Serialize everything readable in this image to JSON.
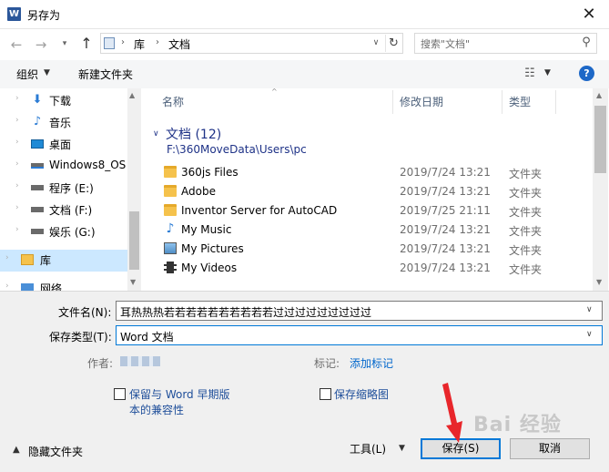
{
  "window": {
    "app_icon": "W",
    "title": "另存为",
    "close_glyph": "✕"
  },
  "address": {
    "crumbs": [
      "库",
      "文档"
    ],
    "search_placeholder": "搜索\"文档\""
  },
  "toolbar": {
    "organize": "组织",
    "new_folder": "新建文件夹",
    "help": "?"
  },
  "nav": {
    "items": [
      {
        "label": "下载",
        "icon": "download-icon"
      },
      {
        "label": "音乐",
        "icon": "music-icon"
      },
      {
        "label": "桌面",
        "icon": "desktop-icon"
      },
      {
        "label": "Windows8_OS",
        "icon": "drive-icon"
      },
      {
        "label": "程序 (E:)",
        "icon": "drive-icon"
      },
      {
        "label": "文档 (F:)",
        "icon": "drive-icon"
      },
      {
        "label": "娱乐 (G:)",
        "icon": "drive-icon"
      },
      {
        "label": "库",
        "icon": "library-icon"
      },
      {
        "label": "网络",
        "icon": "network-icon"
      }
    ]
  },
  "files": {
    "columns": {
      "name": "名称",
      "date": "修改日期",
      "type": "类型"
    },
    "group_title": "文档 (12)",
    "group_path": "F:\\360MoveData\\Users\\pc",
    "rows": [
      {
        "name": "360js Files",
        "date": "2019/7/24 13:21",
        "type": "文件夹",
        "icon": "folder-icon"
      },
      {
        "name": "Adobe",
        "date": "2019/7/24 13:21",
        "type": "文件夹",
        "icon": "folder-icon"
      },
      {
        "name": "Inventor Server for AutoCAD",
        "date": "2019/7/25 21:11",
        "type": "文件夹",
        "icon": "folder-icon"
      },
      {
        "name": "My Music",
        "date": "2019/7/24 13:21",
        "type": "文件夹",
        "icon": "music-folder-icon"
      },
      {
        "name": "My Pictures",
        "date": "2019/7/24 13:21",
        "type": "文件夹",
        "icon": "pictures-folder-icon"
      },
      {
        "name": "My Videos",
        "date": "2019/7/24 13:21",
        "type": "文件夹",
        "icon": "videos-folder-icon"
      }
    ]
  },
  "form": {
    "filename_label": "文件名(N):",
    "filename_value": "耳热热热若若若若若若若若若若过过过过过过过过过",
    "filetype_label": "保存类型(T):",
    "filetype_value": "Word 文档",
    "author_label": "作者:",
    "tags_label": "标记:",
    "tags_link": "添加标记",
    "compat_line1": "保留与 Word 早期版",
    "compat_line2": "本的兼容性",
    "thumbnail": "保存缩略图",
    "hide_folders": "隐藏文件夹",
    "tools": "工具(L)",
    "save": "保存(S)",
    "cancel": "取消"
  },
  "watermark": "Bai 经验",
  "colors": {
    "accent": "#0078d7",
    "link": "#0066cc",
    "group_heading": "#1e3287",
    "selection": "#cce8ff",
    "annotation": "#e8262b"
  }
}
